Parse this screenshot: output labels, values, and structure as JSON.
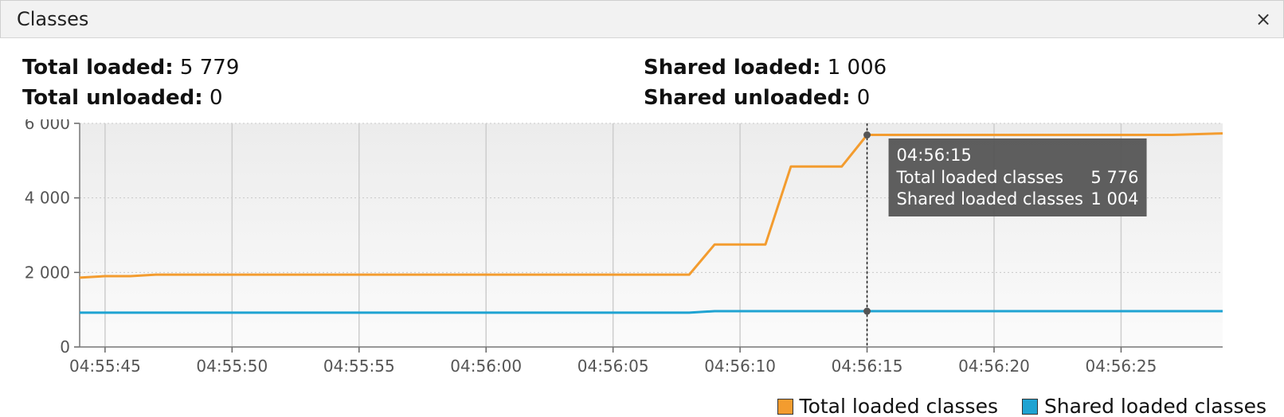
{
  "panel": {
    "title": "Classes",
    "close_icon": "close-icon"
  },
  "stats": {
    "total_loaded_label": "Total loaded:",
    "total_loaded_value": "5 779",
    "total_unloaded_label": "Total unloaded:",
    "total_unloaded_value": "0",
    "shared_loaded_label": "Shared loaded:",
    "shared_loaded_value": "1 006",
    "shared_unloaded_label": "Shared unloaded:",
    "shared_unloaded_value": "0"
  },
  "tooltip": {
    "time": "04:56:15",
    "rows": [
      {
        "label": "Total loaded classes",
        "value": "5 776"
      },
      {
        "label": "Shared loaded classes",
        "value": "1 004"
      }
    ]
  },
  "colors": {
    "total": "#f39c2f",
    "shared": "#1fa3d2",
    "tooltip_bg": "#555555"
  },
  "chart_data": {
    "type": "line",
    "x_type": "time",
    "ylim": [
      0,
      6000
    ],
    "xlim": [
      "04:55:44",
      "04:56:29"
    ],
    "y_ticks": [
      {
        "value": 0,
        "label": "0"
      },
      {
        "value": 2000,
        "label": "2 000"
      },
      {
        "value": 4000,
        "label": "4 000"
      },
      {
        "value": 6000,
        "label": "6 000"
      }
    ],
    "x_ticks": [
      {
        "value": "04:55:45",
        "label": "04:55:45"
      },
      {
        "value": "04:55:50",
        "label": "04:55:50"
      },
      {
        "value": "04:55:55",
        "label": "04:55:55"
      },
      {
        "value": "04:56:00",
        "label": "04:56:00"
      },
      {
        "value": "04:56:05",
        "label": "04:56:05"
      },
      {
        "value": "04:56:10",
        "label": "04:56:10"
      },
      {
        "value": "04:56:15",
        "label": "04:56:15"
      },
      {
        "value": "04:56:20",
        "label": "04:56:20"
      },
      {
        "value": "04:56:25",
        "label": "04:56:25"
      }
    ],
    "series": [
      {
        "name": "Total loaded classes",
        "color": "#f39c2f",
        "points": [
          [
            "04:55:44",
            1860
          ],
          [
            "04:55:45",
            1900
          ],
          [
            "04:55:46",
            1900
          ],
          [
            "04:55:47",
            1940
          ],
          [
            "04:56:08",
            1940
          ],
          [
            "04:56:09",
            2750
          ],
          [
            "04:56:11",
            2750
          ],
          [
            "04:56:12",
            4840
          ],
          [
            "04:56:14",
            4840
          ],
          [
            "04:56:15",
            5690
          ],
          [
            "04:56:27",
            5690
          ],
          [
            "04:56:29",
            5730
          ]
        ]
      },
      {
        "name": "Shared loaded classes",
        "color": "#1fa3d2",
        "points": [
          [
            "04:55:44",
            920
          ],
          [
            "04:56:08",
            920
          ],
          [
            "04:56:09",
            960
          ],
          [
            "04:56:29",
            960
          ]
        ]
      }
    ],
    "cursor_time": "04:56:15",
    "legend_position": "bottom-right",
    "grid": true
  }
}
